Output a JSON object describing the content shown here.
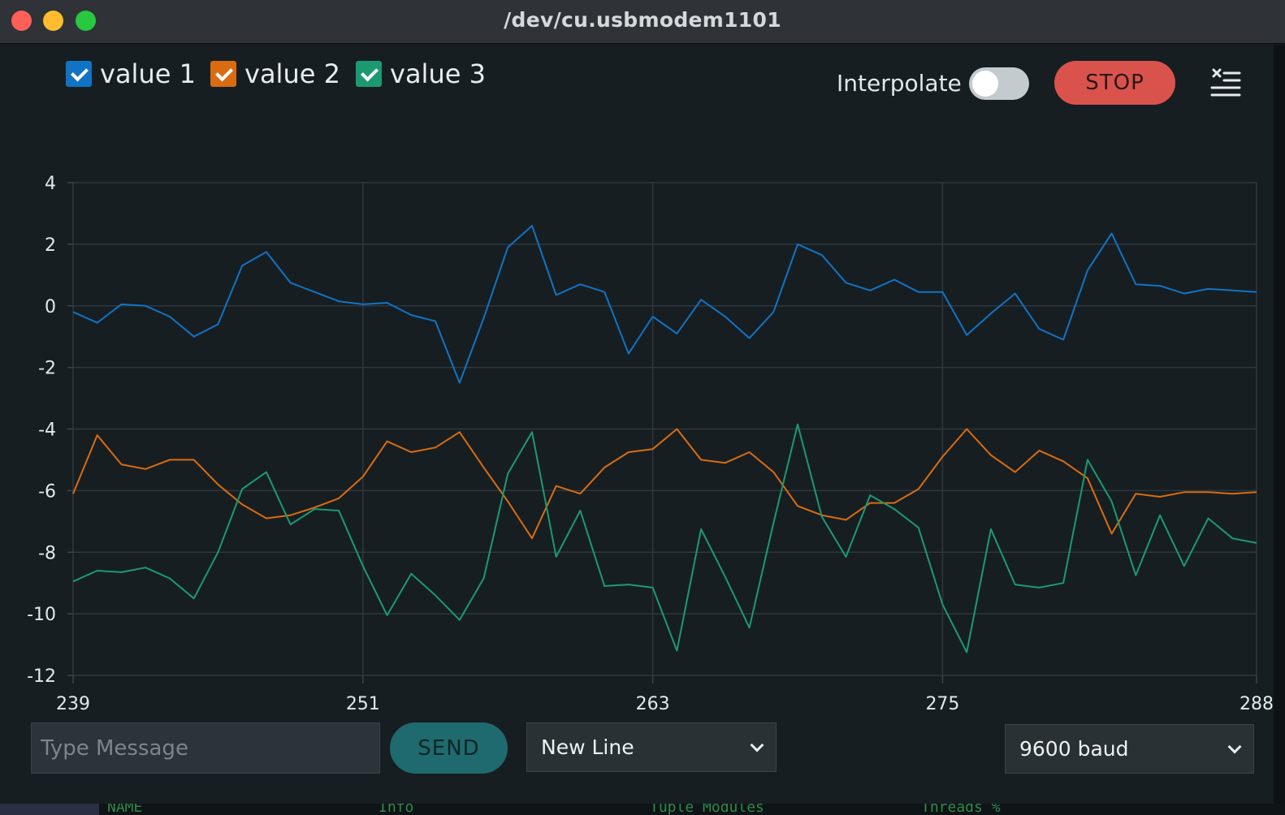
{
  "window": {
    "title": "/dev/cu.usbmodem1101"
  },
  "legend": [
    {
      "label": "value 1",
      "color": "#1173c4"
    },
    {
      "label": "value 2",
      "color": "#d96c11"
    },
    {
      "label": "value 3",
      "color": "#1b9a72"
    }
  ],
  "controls": {
    "interpolate_label": "Interpolate",
    "interpolate_on": false,
    "stop_label": "STOP"
  },
  "input": {
    "placeholder": "Type Message",
    "send_label": "SEND"
  },
  "line_ending": {
    "selected": "New Line"
  },
  "baud": {
    "selected": "9600 baud"
  },
  "background_text": [
    "NAME",
    "Info",
    "Tuple Modules",
    "Threads  %"
  ],
  "chart_data": {
    "type": "line",
    "x": [
      239,
      240,
      241,
      242,
      243,
      244,
      245,
      246,
      247,
      248,
      249,
      250,
      251,
      252,
      253,
      254,
      255,
      256,
      257,
      258,
      259,
      260,
      261,
      262,
      263,
      264,
      265,
      266,
      267,
      268,
      269,
      270,
      271,
      272,
      273,
      274,
      275,
      276,
      277,
      278,
      279,
      280,
      281,
      282,
      283,
      284,
      285,
      286,
      287,
      288
    ],
    "xlim": [
      239,
      288
    ],
    "xticks": [
      "239",
      "251",
      "263",
      "275",
      "288"
    ],
    "ylim": [
      -12,
      4
    ],
    "yticks": [
      "4",
      "2",
      "0",
      "-2",
      "-4",
      "-6",
      "-8",
      "-10",
      "-12"
    ],
    "grid": true,
    "series": [
      {
        "name": "value 1",
        "color": "#1173c4",
        "values": [
          -0.2,
          -0.55,
          0.05,
          0,
          -0.35,
          -1,
          -0.6,
          1.3,
          1.75,
          0.75,
          0.45,
          0.15,
          0.05,
          0.1,
          -0.3,
          -0.5,
          -2.5,
          -0.4,
          1.9,
          2.6,
          0.35,
          0.7,
          0.45,
          -1.55,
          -0.35,
          -0.9,
          0.2,
          -0.35,
          -1.05,
          -0.2,
          2,
          1.65,
          0.75,
          0.5,
          0.85,
          0.45,
          0.45,
          -0.95,
          -0.25,
          0.4,
          -0.75,
          -1.1,
          1.15,
          2.35,
          0.7,
          0.65,
          0.4,
          0.55,
          0.5,
          0.45
        ]
      },
      {
        "name": "value 2",
        "color": "#d96c11",
        "values": [
          -6.1,
          -4.2,
          -5.15,
          -5.3,
          -5,
          -5,
          -5.8,
          -6.45,
          -6.9,
          -6.8,
          -6.55,
          -6.25,
          -5.55,
          -4.4,
          -4.75,
          -4.6,
          -4.1,
          -5.25,
          -6.35,
          -7.55,
          -5.85,
          -6.1,
          -5.25,
          -4.75,
          -4.65,
          -4,
          -5,
          -5.1,
          -4.75,
          -5.4,
          -6.5,
          -6.8,
          -6.95,
          -6.4,
          -6.4,
          -5.95,
          -4.9,
          -4,
          -4.85,
          -5.4,
          -4.7,
          -5.05,
          -5.6,
          -7.4,
          -6.1,
          -6.2,
          -6.05,
          -6.05,
          -6.1,
          -6.05
        ]
      },
      {
        "name": "value 3",
        "color": "#1b9a72",
        "values": [
          -8.95,
          -8.6,
          -8.65,
          -8.5,
          -8.85,
          -9.5,
          -8,
          -5.95,
          -5.4,
          -7.1,
          -6.6,
          -6.65,
          -8.45,
          -10.05,
          -8.7,
          -9.4,
          -10.2,
          -8.85,
          -5.45,
          -4.1,
          -8.15,
          -6.65,
          -9.1,
          -9.05,
          -9.15,
          -11.2,
          -7.25,
          -8.8,
          -10.45,
          -7.05,
          -3.85,
          -6.85,
          -8.15,
          -6.15,
          -6.6,
          -7.2,
          -9.7,
          -11.25,
          -7.25,
          -9.05,
          -9.15,
          -9,
          -5,
          -6.35,
          -8.75,
          -6.8,
          -8.45,
          -6.9,
          -7.55,
          -7.7
        ]
      }
    ]
  }
}
